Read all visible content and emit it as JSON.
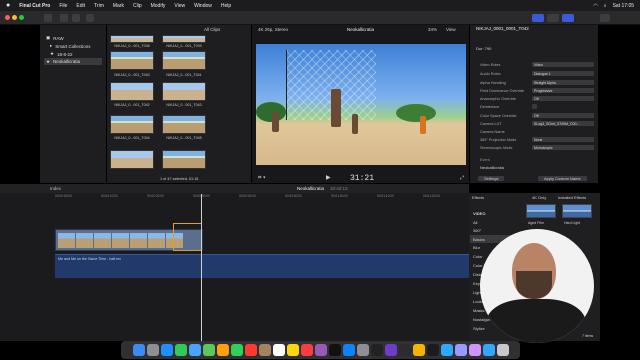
{
  "menubar": {
    "apple_icon": "apple-icon",
    "app_name": "Final Cut Pro",
    "items": [
      "File",
      "Edit",
      "Trim",
      "Mark",
      "Clip",
      "Modify",
      "View",
      "Window",
      "Help"
    ],
    "clock": "Sat 17:05"
  },
  "libraries": {
    "items": [
      {
        "label": "RAW"
      },
      {
        "label": "Smart Collections"
      },
      {
        "label": "18-8-22"
      },
      {
        "label": "Neokallicratia"
      }
    ]
  },
  "browser": {
    "filter_label": "All Clips",
    "clips": [
      "NIKJAJ_0...001_T038",
      "NIKJAJ_0...001_T039",
      "NIKJAJ_0...001_T040",
      "NIKJAJ_0...001_T041",
      "NIKJAJ_0...001_T042",
      "NIKJAJ_0...001_T043",
      "NIKJAJ_0...001_T044",
      "NIKJAJ_0...001_T045"
    ],
    "status": "1 of 47 selected, 01:15"
  },
  "viewer": {
    "format": "4K 25p, Stereo",
    "project": "Neokallicratia",
    "zoom": "34%",
    "view_label": "View",
    "timecode": "31:21"
  },
  "inspector": {
    "clip_name": "NIKJAJ_0001_0001_T042",
    "duration": "Dur: 790",
    "rows": [
      {
        "key": "Video Roles",
        "value": "Video"
      },
      {
        "key": "Audio Roles",
        "value": "Dialogue 1"
      },
      {
        "key": "Alpha Handling",
        "value": "Straight Alpha"
      },
      {
        "key": "Field Dominance Override",
        "value": "Progressive"
      },
      {
        "key": "Anamorphic Override",
        "value": "Off"
      },
      {
        "key": "Deinterlace",
        "value": ""
      },
      {
        "key": "Color Space Override",
        "value": "Off"
      },
      {
        "key": "Camera LUT",
        "value": "SLog3_SGmt_S709M_C00..."
      },
      {
        "key": "Camera Name",
        "value": ""
      },
      {
        "key": "360° Projection Mode",
        "value": "None"
      },
      {
        "key": "Stereoscopic Mode",
        "value": "Monoscopic"
      }
    ],
    "event_label": "Event",
    "event_value": "Neokallicratia",
    "settings_button": "Settings",
    "custom_button": "Apply Custom Name"
  },
  "timeline": {
    "index_label": "Index",
    "project": "Neokallicratia",
    "duration": "10:40:13",
    "ruler": [
      "00:00:00:00",
      "00:00:10:00",
      "00:00:20:00",
      "00:00:30:00",
      "00:00:40:00",
      "00:00:50:00",
      "00:01:00:00",
      "00:01:10:00",
      "00:01:20:00"
    ],
    "audio_label": "Me and Me on the Same Time - half.mx"
  },
  "effects": {
    "title": "Effects",
    "filter_4k": "4K Only",
    "installed": "Installed Effects",
    "categories": [
      "VIDEO",
      "All",
      "360°",
      "Basics",
      "Blur",
      "Color",
      "Color Presets",
      "Distortion",
      "Keying",
      "Light",
      "Looks",
      "Masks",
      "Nostalgia",
      "Stylize",
      "Text Effects"
    ],
    "selected_category": "Basics",
    "thumbs": [
      "Aged Film",
      "Hard Light"
    ],
    "count": "7 items"
  },
  "dock": {
    "apps": [
      "finder-icon",
      "launchpad-icon",
      "safari-icon",
      "messages-icon",
      "mail-icon",
      "maps-icon",
      "photos-icon",
      "facetime-icon",
      "calendar-icon",
      "contacts-icon",
      "reminders-icon",
      "notes-icon",
      "music-icon",
      "podcasts-icon",
      "tv-icon",
      "appstore-icon",
      "settings-icon",
      "finalcut-icon",
      "motion-icon",
      "compressor-icon",
      "chrome-icon",
      "terminal-icon",
      "photoshop-icon",
      "premiere-icon",
      "aftereffects-icon",
      "lightroom-icon",
      "trash-icon"
    ]
  },
  "colors": {
    "accent": "#3b5bd6",
    "timeline_audio": "#22396b",
    "clip_video": "#5a6f8e",
    "selected_clip": "#e0a021"
  }
}
